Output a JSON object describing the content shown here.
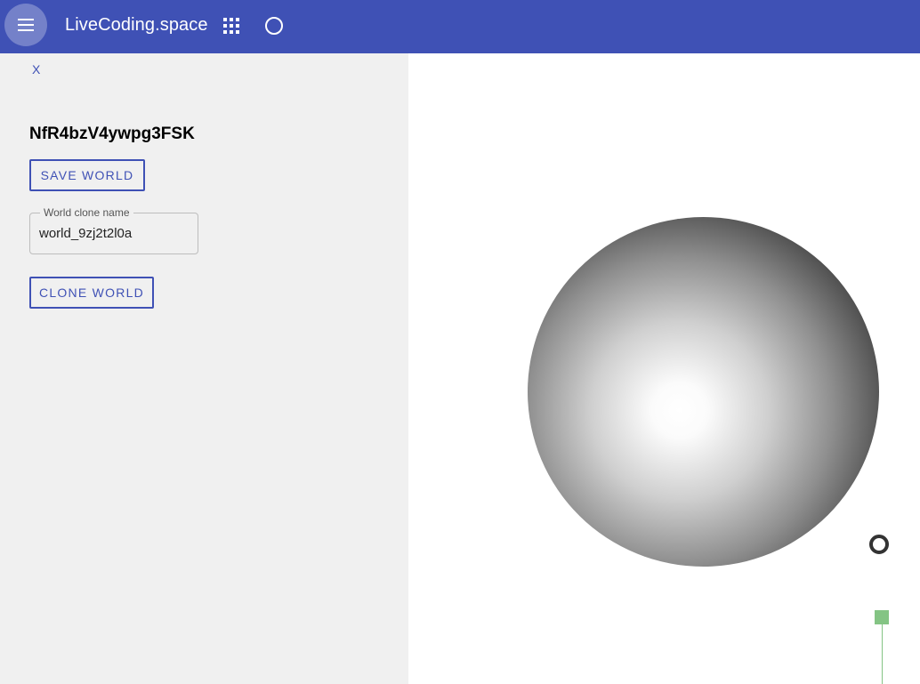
{
  "header": {
    "title": "LiveCoding.space",
    "menu_icon": "menu-icon",
    "apps_icon": "apps-grid-icon",
    "circle_icon": "circle-icon",
    "background_color": "#3f51b5"
  },
  "sidebar": {
    "close_label": "X",
    "world_id": "NfR4bzV4ywpg3FSK",
    "save_button_label": "SAVE WORLD",
    "clone_field": {
      "label": "World clone name",
      "value": "world_9zj2t2l0a"
    },
    "clone_button_label": "CLONE WORLD"
  },
  "viewport": {
    "objects": [
      "sphere",
      "ring-marker",
      "green-marker"
    ]
  }
}
